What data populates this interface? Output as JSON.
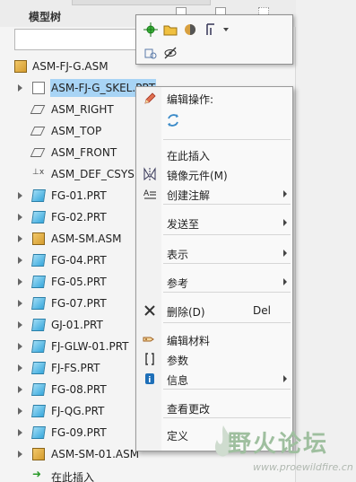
{
  "panel": {
    "title": "模型树"
  },
  "tree": {
    "root": "ASM-FJ-G.ASM",
    "items": [
      {
        "label": "ASM-FJ-G_SKEL.PRT",
        "type": "skel",
        "expandable": true,
        "selected": true
      },
      {
        "label": "ASM_RIGHT",
        "type": "plane",
        "expandable": false
      },
      {
        "label": "ASM_TOP",
        "type": "plane",
        "expandable": false
      },
      {
        "label": "ASM_FRONT",
        "type": "plane",
        "expandable": false
      },
      {
        "label": "ASM_DEF_CSYS",
        "type": "csys",
        "expandable": false
      },
      {
        "label": "FG-01.PRT",
        "type": "prt",
        "expandable": true
      },
      {
        "label": "FG-02.PRT",
        "type": "prt",
        "expandable": true
      },
      {
        "label": "ASM-SM.ASM",
        "type": "asm",
        "expandable": true
      },
      {
        "label": "FG-04.PRT",
        "type": "prt",
        "expandable": true
      },
      {
        "label": "FG-05.PRT",
        "type": "prt",
        "expandable": true
      },
      {
        "label": "FG-07.PRT",
        "type": "prt",
        "expandable": true
      },
      {
        "label": "GJ-01.PRT",
        "type": "prt",
        "expandable": true
      },
      {
        "label": "FJ-GLW-01.PRT",
        "type": "prt",
        "expandable": true
      },
      {
        "label": "FJ-FS.PRT",
        "type": "prt",
        "expandable": true
      },
      {
        "label": "FG-08.PRT",
        "type": "prt",
        "expandable": true
      },
      {
        "label": "FJ-QG.PRT",
        "type": "prt",
        "expandable": true
      },
      {
        "label": "FG-09.PRT",
        "type": "prt",
        "expandable": true
      },
      {
        "label": "ASM-SM-01.ASM",
        "type": "asm",
        "expandable": true
      },
      {
        "label": "在此插入",
        "type": "insert",
        "expandable": false
      }
    ]
  },
  "menu": {
    "edit_ops_label": "编辑操作:",
    "items": [
      {
        "label": "在此插入",
        "icon": "",
        "submenu": false
      },
      {
        "label": "镜像元件(M)",
        "icon": "mirror-icon",
        "submenu": false
      },
      {
        "label": "创建注解",
        "icon": "annotation-icon",
        "submenu": true
      },
      {
        "label": "发送至",
        "icon": "",
        "submenu": true
      },
      {
        "label": "表示",
        "icon": "",
        "submenu": true
      },
      {
        "label": "参考",
        "icon": "",
        "submenu": true
      },
      {
        "label": "删除(D)",
        "icon": "delete-icon",
        "submenu": false,
        "shortcut": "Del"
      },
      {
        "label": "编辑材料",
        "icon": "material-icon",
        "submenu": false
      },
      {
        "label": "参数",
        "icon": "parameters-icon",
        "submenu": false
      },
      {
        "label": "信息",
        "icon": "info-icon",
        "submenu": true
      },
      {
        "label": "查看更改",
        "icon": "",
        "submenu": false
      },
      {
        "label": "定义",
        "icon": "",
        "submenu": false
      }
    ]
  },
  "watermark": {
    "text": "野火论坛",
    "url": "www.proewildfire.cn"
  },
  "colors": {
    "selection": "#a8d4f5",
    "asm_icon": "#e0b040",
    "prt_icon": "#38a8dc"
  }
}
